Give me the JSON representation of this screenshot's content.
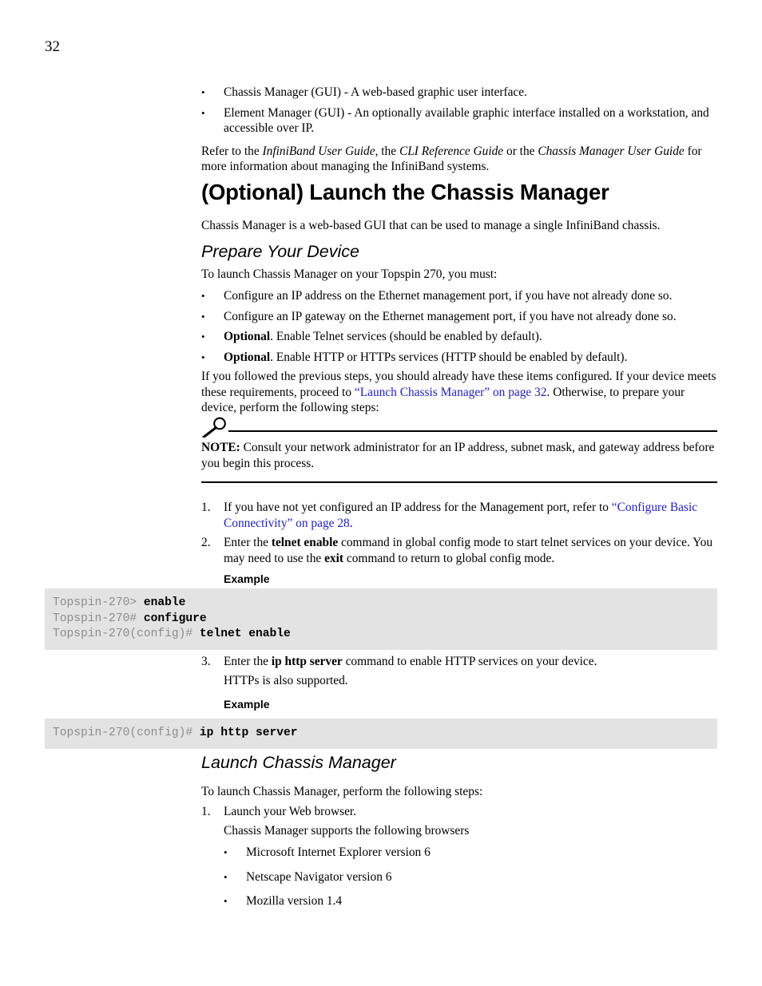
{
  "page": {
    "folio": "32"
  },
  "intro": {
    "bullets": [
      "Chassis Manager (GUI) - A web-based graphic user interface.",
      "Element Manager (GUI) - An optionally available graphic interface installed on a workstation, and accessible over IP."
    ],
    "refer": {
      "t1": "Refer to the ",
      "i1": "InfiniBand User Guide",
      "t2": ", the ",
      "i2": "CLI Reference Guide",
      "t3": " or the ",
      "i3": "Chassis Manager User Guide",
      "t4": " for more information about managing the InfiniBand systems."
    }
  },
  "section_optional": {
    "heading": "(Optional) Launch the Chassis Manager",
    "intro": "Chassis Manager is a web-based GUI that can be used to manage a single InfiniBand chassis."
  },
  "prepare": {
    "heading": "Prepare Your Device",
    "lead": "To launch Chassis Manager on your Topspin 270, you must:",
    "bullets": [
      {
        "bold": "",
        "text": "Configure an IP address on the Ethernet management port, if you have not already done so."
      },
      {
        "bold": "",
        "text": "Configure an IP gateway on the Ethernet management port, if you have not already done so."
      },
      {
        "bold": "Optional",
        "text": ". Enable Telnet services (should be enabled by default)."
      },
      {
        "bold": "Optional",
        "text": ". Enable HTTP or HTTPs services (HTTP should be enabled by default)."
      }
    ],
    "followup": {
      "t1": "If you followed the previous steps, you should already have these items configured. If your device meets these requirements, proceed to ",
      "link": "“Launch Chassis Manager” on page 32",
      "t2": ". Otherwise, to prepare your device, perform the following steps:"
    }
  },
  "note": {
    "icon": "magnifier-icon",
    "label": "NOTE:",
    "text": " Consult your network administrator for an IP address, subnet mask, and gateway address before you begin this process."
  },
  "steps_prepare": {
    "step1": {
      "num": "1.",
      "t1": "If you have not yet configured an IP address for the Management port, refer to ",
      "link": "“Configure Basic Connectivity” on page 28",
      "t2": "."
    },
    "step2": {
      "num": "2.",
      "t1": "Enter the ",
      "b1": "telnet enable",
      "t2": " command in global config mode to start telnet services on your device. You may need to use the ",
      "b2": "exit",
      "t3": " command to return to global config mode."
    },
    "example_label_1": "Example",
    "step3": {
      "num": "3.",
      "t1": "Enter the ",
      "b1": "ip http server",
      "t2": " command to enable HTTP services on your device.",
      "sub": "HTTPs is also supported."
    },
    "example_label_2": "Example"
  },
  "code_block_1": {
    "lines": [
      {
        "prompt": "Topspin-270> ",
        "command": "enable"
      },
      {
        "prompt": "Topspin-270# ",
        "command": "configure"
      },
      {
        "prompt": "Topspin-270(config)# ",
        "command": "telnet enable"
      }
    ]
  },
  "code_block_2": {
    "lines": [
      {
        "prompt": "Topspin-270(config)# ",
        "command": "ip http server"
      }
    ]
  },
  "launch": {
    "heading": "Launch Chassis Manager",
    "lead": "To launch Chassis Manager, perform the following steps:",
    "step1": {
      "num": "1.",
      "text": "Launch your Web browser.",
      "sub": "Chassis Manager supports the following browsers",
      "bullets": [
        "Microsoft Internet Explorer version 6",
        "Netscape Navigator version 6",
        "Mozilla version 1.4"
      ]
    }
  }
}
